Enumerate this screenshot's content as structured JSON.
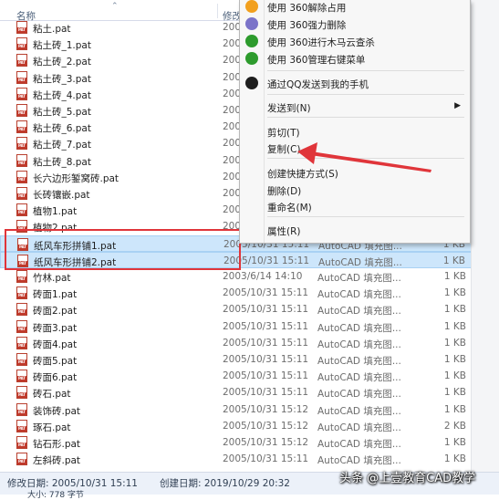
{
  "header": {
    "col_name": "名称",
    "col_date": "修改",
    "sort_glyph": "⌃"
  },
  "file_icon_text": "PAT",
  "files": [
    {
      "name": "粘土.pat",
      "date": "200",
      "type": "",
      "size": ""
    },
    {
      "name": "粘土砖_1.pat",
      "date": "200",
      "type": "",
      "size": ""
    },
    {
      "name": "粘土砖_2.pat",
      "date": "200",
      "type": "",
      "size": ""
    },
    {
      "name": "粘土砖_3.pat",
      "date": "200",
      "type": "",
      "size": ""
    },
    {
      "name": "粘土砖_4.pat",
      "date": "200",
      "type": "",
      "size": ""
    },
    {
      "name": "粘土砖_5.pat",
      "date": "200",
      "type": "",
      "size": ""
    },
    {
      "name": "粘土砖_6.pat",
      "date": "200",
      "type": "",
      "size": ""
    },
    {
      "name": "粘土砖_7.pat",
      "date": "200",
      "type": "",
      "size": ""
    },
    {
      "name": "粘土砖_8.pat",
      "date": "200",
      "type": "",
      "size": ""
    },
    {
      "name": "长六边形錾窝砖.pat",
      "date": "200",
      "type": "",
      "size": ""
    },
    {
      "name": "长砖镶嵌.pat",
      "date": "200",
      "type": "",
      "size": ""
    },
    {
      "name": "植物1.pat",
      "date": "200",
      "type": "",
      "size": ""
    },
    {
      "name": "植物2.pat",
      "date": "200",
      "type": "",
      "size": ""
    },
    {
      "name": "纸风车形拼铺1.pat",
      "date": "2005/10/31 15:11",
      "type": "AutoCAD 填充图...",
      "size": "1 KB"
    },
    {
      "name": "纸风车形拼铺2.pat",
      "date": "2005/10/31 15:11",
      "type": "AutoCAD 填充图...",
      "size": "1 KB"
    },
    {
      "name": "竹林.pat",
      "date": "2003/6/14 14:10",
      "type": "AutoCAD 填充图...",
      "size": "1 KB"
    },
    {
      "name": "砖面1.pat",
      "date": "2005/10/31 15:11",
      "type": "AutoCAD 填充图...",
      "size": "1 KB"
    },
    {
      "name": "砖面2.pat",
      "date": "2005/10/31 15:11",
      "type": "AutoCAD 填充图...",
      "size": "1 KB"
    },
    {
      "name": "砖面3.pat",
      "date": "2005/10/31 15:11",
      "type": "AutoCAD 填充图...",
      "size": "1 KB"
    },
    {
      "name": "砖面4.pat",
      "date": "2005/10/31 15:11",
      "type": "AutoCAD 填充图...",
      "size": "1 KB"
    },
    {
      "name": "砖面5.pat",
      "date": "2005/10/31 15:11",
      "type": "AutoCAD 填充图...",
      "size": "1 KB"
    },
    {
      "name": "砖面6.pat",
      "date": "2005/10/31 15:11",
      "type": "AutoCAD 填充图...",
      "size": "1 KB"
    },
    {
      "name": "砖石.pat",
      "date": "2005/10/31 15:11",
      "type": "AutoCAD 填充图...",
      "size": "1 KB"
    },
    {
      "name": "装饰砖.pat",
      "date": "2005/10/31 15:12",
      "type": "AutoCAD 填充图...",
      "size": "1 KB"
    },
    {
      "name": "琢石.pat",
      "date": "2005/10/31 15:12",
      "type": "AutoCAD 填充图...",
      "size": "2 KB"
    },
    {
      "name": "钻石形.pat",
      "date": "2005/10/31 15:12",
      "type": "AutoCAD 填充图...",
      "size": "1 KB"
    },
    {
      "name": "左斜砖.pat",
      "date": "2005/10/31 15:11",
      "type": "AutoCAD 填充图...",
      "size": "1 KB"
    }
  ],
  "selected_files": [
    "纸风车形拼铺1.pat",
    "纸风车形拼铺2.pat"
  ],
  "context_menu": {
    "items": [
      {
        "label": "使用 360解除占用",
        "icon": "360-unlock-icon",
        "color": "#f2a01e"
      },
      {
        "label": "使用 360强力删除",
        "icon": "360-shred-icon",
        "color": "#7b74c9"
      },
      {
        "label": "使用 360进行木马云查杀",
        "icon": "360-scan-icon",
        "color": "#2d9b2d"
      },
      {
        "label": "使用 360管理右键菜单",
        "icon": "360-menu-icon",
        "color": "#2d9b2d"
      },
      {
        "label": "通过QQ发送到我的手机",
        "icon": "qq-penguin-icon",
        "color": "#1e1e1e"
      },
      {
        "label": "发送到(N)",
        "icon": "",
        "submenu": true
      },
      {
        "label": "剪切(T)",
        "icon": ""
      },
      {
        "label": "复制(C)",
        "icon": ""
      },
      {
        "label": "创建快捷方式(S)",
        "icon": ""
      },
      {
        "label": "删除(D)",
        "icon": ""
      },
      {
        "label": "重命名(M)",
        "icon": ""
      },
      {
        "label": "属性(R)",
        "icon": ""
      }
    ],
    "submenu_arrow": "▶"
  },
  "status": {
    "modified": "修改日期: 2005/10/31 15:11",
    "created": "创建日期: 2019/10/29 20:32",
    "size": "大小: 778 字节"
  },
  "watermark": "头条 @上壹教育CAD教学",
  "colors": {
    "highlight": "#e0353a",
    "selection": "#cde6fb"
  }
}
